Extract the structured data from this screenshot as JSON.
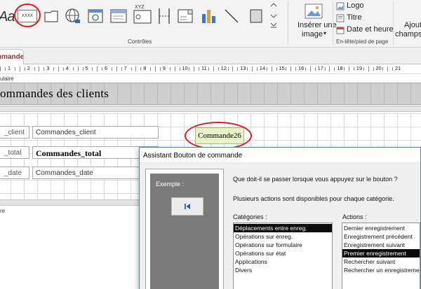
{
  "ribbon": {
    "partial_aa_label": "Aa",
    "textbox_sample": "XXXX",
    "xyz_label": "XYZ",
    "controls_group_label": "Contrôles",
    "insert_image_label_1": "Insérer une",
    "insert_image_label_2": "image",
    "insert_image_caret": "▾",
    "logo_label": "Logo",
    "title_label": "Titre",
    "date_time_label": "Date et heure",
    "header_footer_group_label": "En-tête/pied de page",
    "add_fields_label_1": "Ajouter",
    "add_fields_label_2": "champs"
  },
  "document_tab": {
    "label": "nmandes"
  },
  "ruler": {
    "numbers": [
      "1",
      "2",
      "3",
      "4",
      "5",
      "6",
      "7",
      "8",
      "9",
      "10",
      "11",
      "12",
      "13",
      "14",
      "15",
      "16",
      "17",
      "18",
      "19",
      "20",
      "21"
    ]
  },
  "form": {
    "header_section_label": "ulaire",
    "header_title": "ommandes des clients",
    "detail_rows": [
      {
        "label": "_client",
        "field": "Commandes_client",
        "bold": false
      },
      {
        "label": "_total",
        "field": "Commandes_total",
        "bold": true
      },
      {
        "label": "_date",
        "field": "Commandes_date",
        "bold": false
      }
    ],
    "footer_section_label": "re",
    "command_button": "Commande26"
  },
  "wizard": {
    "title": "Assistant Bouton de commande",
    "example_label": "Exemple :",
    "question": "Que doit-il se passer lorsque vous appuyez sur le bouton ?",
    "info": "Plusieurs actions sont disponibles pour chaque catégorie.",
    "categories_label": "Catégories :",
    "actions_label": "Actions :",
    "categories": [
      {
        "text": "Déplacements entre enreg.",
        "selected": true
      },
      {
        "text": "Opérations sur enreg.",
        "selected": false
      },
      {
        "text": "Opérations sur formulaire",
        "selected": false
      },
      {
        "text": "Opérations sur état",
        "selected": false
      },
      {
        "text": "Applications",
        "selected": false
      },
      {
        "text": "Divers",
        "selected": false
      }
    ],
    "actions": [
      {
        "text": "Dernier enregistrement",
        "selected": false
      },
      {
        "text": "Enregistrement précédent",
        "selected": false
      },
      {
        "text": "Enregistrement suivant",
        "selected": false
      },
      {
        "text": "Premier enregistrement",
        "selected": true
      },
      {
        "text": "Rechercher suivant",
        "selected": false
      },
      {
        "text": "Rechercher un enregistrement",
        "selected": false
      }
    ]
  },
  "colors": {
    "selection": "#0b0b0b",
    "annotation_circle": "#e01b1b",
    "command_button_fill": "#e9f1c9",
    "tab_text": "#9b2d2d"
  }
}
